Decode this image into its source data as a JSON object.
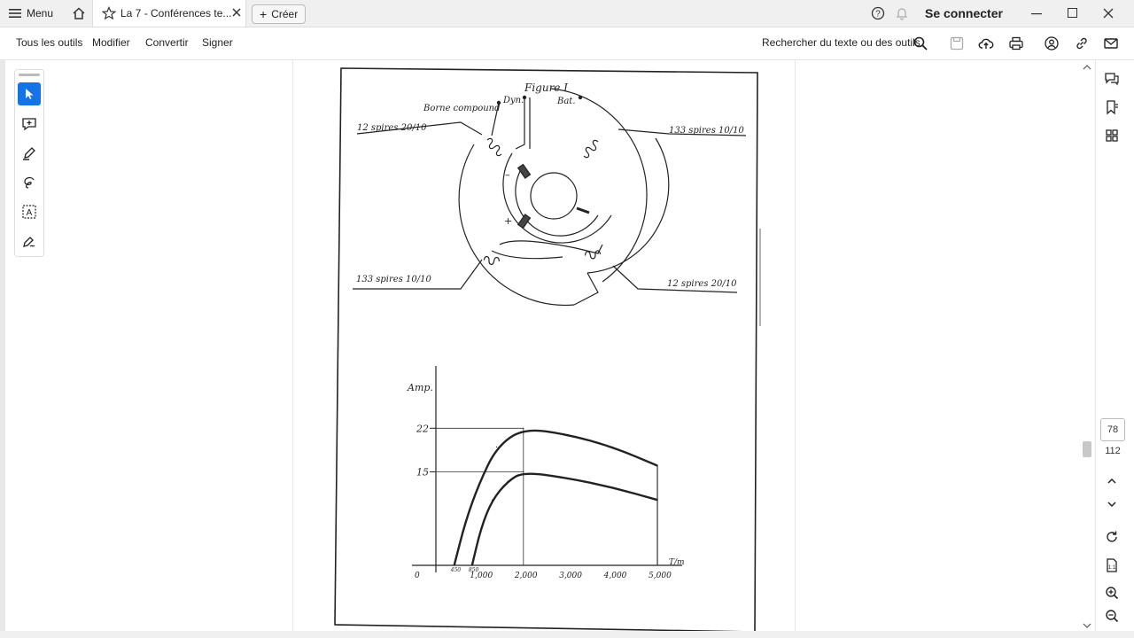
{
  "titlebar": {
    "menu_label": "Menu",
    "tab_title": "La 7 - Conférences te...",
    "create_label": "Créer",
    "signin_label": "Se connecter"
  },
  "toolbar": {
    "all_tools": "Tous les outils",
    "edit": "Modifier",
    "convert": "Convertir",
    "sign": "Signer",
    "search_label": "Rechercher du texte ou des outils"
  },
  "pagination": {
    "current_page": "78",
    "total_pages": "112"
  },
  "document": {
    "figure_title": "Figure I",
    "labels": {
      "dyn": "Dyn.",
      "bat": "Bat.",
      "borne": "Borne compound",
      "left_top": "12 spires  20/10",
      "right_top": "133 spires  10/10",
      "left_bottom": "133 spires  10/10",
      "right_bottom": "12 spires  20/10",
      "minus": "–",
      "plus": "+"
    }
  },
  "chart_data": {
    "type": "line",
    "title": "",
    "xlabel": "T/m",
    "ylabel": "Amp.",
    "x_ticks": [
      "0",
      "450",
      "850",
      "1,000",
      "2,000",
      "3,000",
      "4,000",
      "5,000"
    ],
    "y_ticks": [
      "15",
      "22"
    ],
    "xlim": [
      0,
      5500
    ],
    "ylim": [
      0,
      32
    ],
    "series": [
      {
        "name": "",
        "x": [
          450,
          700,
          1000,
          1400,
          2000,
          3000,
          4000,
          5000
        ],
        "y": [
          0,
          7,
          13,
          19,
          22,
          21,
          19,
          16
        ]
      },
      {
        "name": "",
        "x": [
          850,
          1050,
          1300,
          1650,
          2000,
          3000,
          4000,
          5000
        ],
        "y": [
          0,
          6,
          10.5,
          13.5,
          15,
          14,
          12.5,
          10.5
        ]
      }
    ]
  }
}
